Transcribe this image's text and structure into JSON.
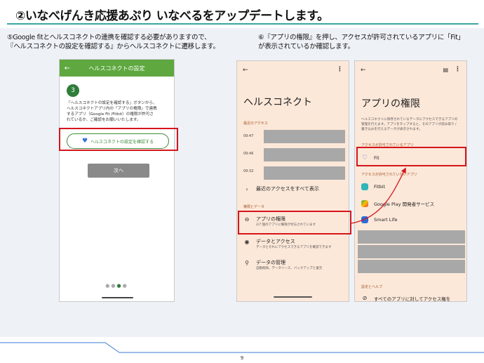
{
  "slide": {
    "title": "②いなべげんき応援あぷり いなべるをアップデートします。",
    "page_number": "9"
  },
  "steps": {
    "step5_line1": "⑤Google fitとヘルスコネクトの連携を確認する必要がありますので、",
    "step5_line2": "『ヘルスコネクトの設定を確認する』からヘルスコネクトに遷移します。",
    "step6_line1": "⑥『アプリの権限』を押し、アクセスが許可されているアプリに「Fit」",
    "step6_line2": "が表示されているか確認します。"
  },
  "phone1": {
    "header_title": "ヘルスコネクトの設定",
    "step_number": "3",
    "description": [
      "「ヘルスコネクトの設定を確認する」ボタンから、",
      "ヘルスコネクトアプリ内の「アプリの権限」で連携",
      "するアプリ（Google Fit /Fitbit）の権限が許可さ",
      "れているか、ご確認をお願いいたします。"
    ],
    "healthconnect_button": "ヘルスコネクトの設定を確認する",
    "next_button": "次へ"
  },
  "phone2": {
    "title": "ヘルスコネクト",
    "recent_access_label": "最近のアクセス",
    "times": [
      "09:47",
      "09:46",
      "09:32"
    ],
    "see_all_recent": "最近のアクセスをすべて表示",
    "permissions_data_label": "権限とデータ",
    "app_permissions_title": "アプリの権限",
    "app_permissions_sub": "2/7 個のアプリに権限が付与されています",
    "data_access_title": "データとアクセス",
    "data_access_sub": "データとそれにアクセスできるアプリを確認できます",
    "manage_data_title": "データの管理",
    "manage_data_sub": "自動削除、データソース、バックアップと復元"
  },
  "phone3": {
    "title": "アプリの権限",
    "description": [
      "ヘルスコネクトに保存されているデータにアクセスできるアプリの",
      "管理を行えます。アプリをタップすると、そのアプリが読み取り /",
      "書き込みを行えるデータが表示されます。"
    ],
    "allowed_label": "アクセスが許可されているアプリ",
    "allowed_apps": [
      "Fit"
    ],
    "not_allowed_label": "アクセスが許可されていないアプリ",
    "not_allowed_apps": [
      "Fitbit",
      "Google Play 開発者サービス",
      "Smart Life"
    ],
    "settings_help_label": "設定とヘルプ",
    "bottom_item": "すべてのアプリに対してアクセス権を"
  },
  "colors": {
    "accent_teal": "#3aa6a0",
    "highlight_red": "#d6151c",
    "app_bar_green": "#5ea83f",
    "phone_bg": "#fce8d9"
  }
}
